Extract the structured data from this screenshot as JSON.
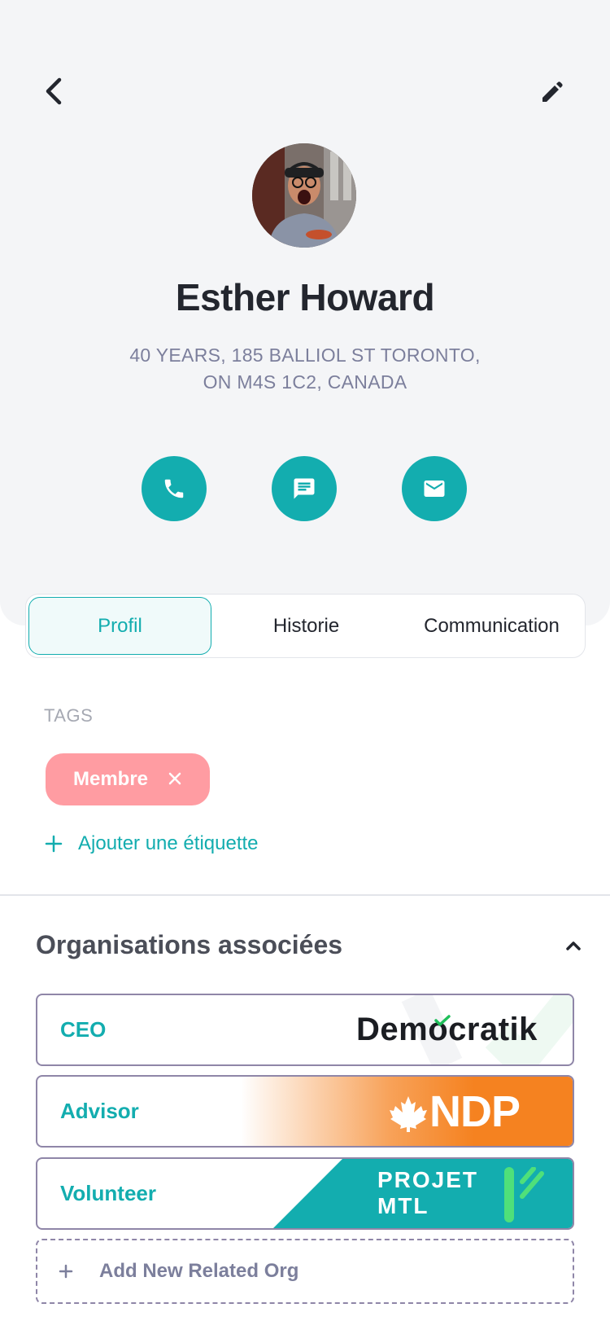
{
  "header": {
    "name": "Esther Howard",
    "address_line1": "40 YEARS, 185 BALLIOL ST TORONTO,",
    "address_line2": "ON M4S 1C2, CANADA",
    "actions": [
      "phone-icon",
      "message-icon",
      "mail-icon"
    ]
  },
  "tabs": [
    {
      "label": "Profil",
      "active": true
    },
    {
      "label": "Historie",
      "active": false
    },
    {
      "label": "Communication",
      "active": false
    }
  ],
  "tags_section": {
    "label": "TAGS",
    "tags": [
      {
        "label": "Membre"
      }
    ],
    "add_label": "Ajouter une étiquette"
  },
  "orgs_section": {
    "title": "Organisations associées",
    "orgs": [
      {
        "role": "CEO",
        "org": "Democratik"
      },
      {
        "role": "Advisor",
        "org": "NDP"
      },
      {
        "role": "Volunteer",
        "org_line1": "PROJET",
        "org_line2": "MTL"
      }
    ],
    "add_label": "Add New Related Org"
  },
  "colors": {
    "accent": "#13adaf",
    "tag_pink": "#ff9ca2",
    "ndp_orange": "#f58220",
    "projet_green": "#13adaf",
    "header_bg": "#f4f5f7"
  }
}
